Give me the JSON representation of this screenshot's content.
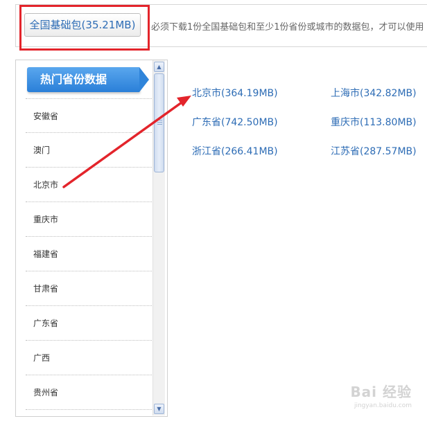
{
  "top_bar": {
    "base_package_button": "全国基础包(35.21MB)",
    "note": "必须下载1份全国基础包和至少1份省份或城市的数据包，才可以使用"
  },
  "left_panel": {
    "header": "热门省份数据",
    "provinces": [
      "安徽省",
      "澳门",
      "北京市",
      "重庆市",
      "福建省",
      "甘肃省",
      "广东省",
      "广西",
      "贵州省"
    ]
  },
  "cities": [
    {
      "label": "北京市(364.19MB)"
    },
    {
      "label": "上海市(342.82MB)"
    },
    {
      "label": "广东省(742.50MB)"
    },
    {
      "label": "重庆市(113.80MB)"
    },
    {
      "label": "浙江省(266.41MB)"
    },
    {
      "label": "江苏省(287.57MB)"
    }
  ],
  "watermark": {
    "logo": "Bai 经验",
    "sub": "jingyan.baidu.com"
  },
  "colors": {
    "link": "#2d6cb5",
    "annotation_red": "#e3242b",
    "header_blue": "#2a7fd8"
  },
  "icons": {
    "scroll_up": "triangle-up",
    "scroll_down": "triangle-down"
  }
}
